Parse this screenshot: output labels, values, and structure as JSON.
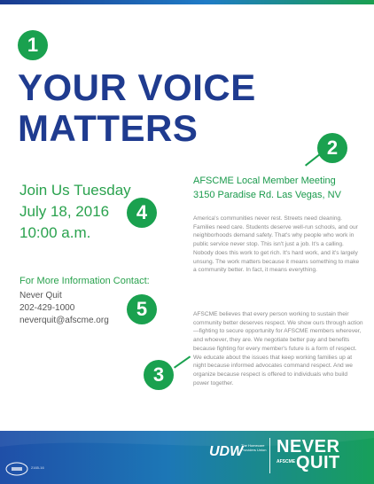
{
  "badges": {
    "b1": "1",
    "b2": "2",
    "b3": "3",
    "b4": "4",
    "b5": "5"
  },
  "headline": {
    "line1": "YOUR VOICE",
    "line2": "MATTERS"
  },
  "event": {
    "line1": "Join Us Tuesday",
    "line2": "July 18, 2016",
    "line3": "10:00 a.m."
  },
  "contact": {
    "heading": "For More Information Contact:",
    "name": "Never Quit",
    "phone": "202-429-1000",
    "email": "neverquit@afscme.org"
  },
  "meeting": {
    "title": "AFSCME Local Member Meeting",
    "address": "3150 Paradise Rd. Las Vegas, NV"
  },
  "body": {
    "p1": "America's communities never rest. Streets need cleaning. Families need care. Students deserve well-run schools, and our neighborhoods demand safety. That's why people who work in public service never stop. This isn't just a job. It's a calling. Nobody does this work to get rich. It's hard work, and it's largely unsung. The work matters because it means something to make a community better. In fact, it means everything.",
    "p2": "AFSCME believes that every person working to sustain their community better deserves respect. We show ours through action—fighting to secure opportunity for AFSCME members wherever, and whoever, they are. We negotiate better pay and benefits because fighting for every member's future is a form of respect. We educate about the issues that keep working families up at night because informed advocates command respect. And we organize because respect is offered to individuals who build power together."
  },
  "footer": {
    "udw_logo": "UDW",
    "udw_sub": "The Homecare Providers Union",
    "never": "NEVER",
    "afscme": "AFSCME",
    "quit": "QUIT",
    "bug_code": "2165-16"
  },
  "colors": {
    "headline_blue": "#1f3b8f",
    "accent_green": "#1aa14f",
    "footer_start": "#1f4fa8",
    "footer_end": "#17a05a"
  }
}
